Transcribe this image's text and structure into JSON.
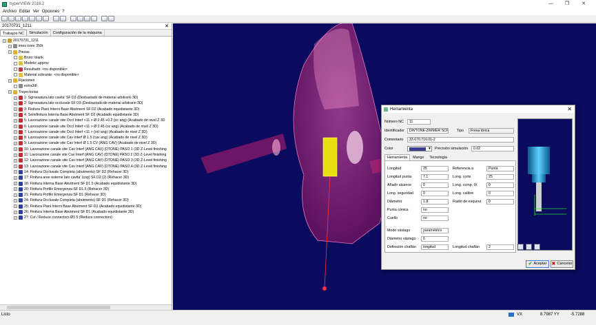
{
  "window": {
    "title": "hyperVIEW 2016.2",
    "controls": [
      "—",
      "❐",
      "✕"
    ]
  },
  "menu": [
    "Archivo",
    "Editar",
    "Ver",
    "Opciones",
    "?"
  ],
  "toolbar": {
    "icons": [
      "new-icon",
      "open-icon",
      "save-icon",
      "print-icon",
      "cut-icon",
      "copy-icon",
      "paste-icon",
      "undo-icon",
      "redo-icon",
      "view-icon",
      "zoom-icon",
      "rotate-icon",
      "fit-icon",
      "measure-icon",
      "line-icon"
    ]
  },
  "left_panel": {
    "header": "20170731_1211",
    "tabs": [
      "Trabajos NC",
      "Simulación",
      "Configuración de la máquina"
    ],
    "tree": [
      {
        "level": 0,
        "text": "20170731_1211",
        "icon": "job-icon",
        "color": "#c8a030"
      },
      {
        "level": 1,
        "text": "imes icore 350i",
        "icon": "machine-icon",
        "color": "#888888"
      },
      {
        "level": 1,
        "text": "Piezas",
        "icon": "folder-icon",
        "color": "#e0b030"
      },
      {
        "level": 2,
        "text": "Bruto: blank",
        "icon": "stock-icon",
        "color": "#e0c040"
      },
      {
        "level": 2,
        "text": "Modelo: approv",
        "icon": "model-icon",
        "color": "#e0c040"
      },
      {
        "level": 2,
        "text": "Resultado: <no disponible>",
        "icon": "result-icon",
        "color": "#c04040"
      },
      {
        "level": 2,
        "text": "Material sobrante: <no disponible>",
        "icon": "rest-icon",
        "color": "#e0c040"
      },
      {
        "level": 1,
        "text": "Fijaciones",
        "icon": "folder-icon",
        "color": "#e0b030"
      },
      {
        "level": 2,
        "text": "extra3df",
        "icon": "fixture-icon",
        "color": "#888888"
      },
      {
        "level": 1,
        "text": "Trayectorias",
        "icon": "folder-icon",
        "color": "#e0b030"
      },
      {
        "level": 2,
        "text": "1: Sgrossatura lato cavita' SF D3 (Desbastado de material arbitrario 3D)",
        "icon": "toolpath-icon",
        "color": "#c03030"
      },
      {
        "level": 2,
        "text": "2: Sgrossatura lato occlusale SF D3 (Desbastado de material arbitrario 3D)",
        "icon": "toolpath-icon",
        "color": "#c03030"
      },
      {
        "level": 2,
        "text": "3: Finitura Piani Interni Base Abutment SF D2 (Acabado equidistante 3D)",
        "icon": "toolpath-icon",
        "color": "#c03030"
      },
      {
        "level": 2,
        "text": "4: Semifinitura Interna Base Abutment SF D2 (Acabado equidistante 3D)",
        "icon": "toolpath-icon",
        "color": "#c03030"
      },
      {
        "level": 2,
        "text": "5: Lavorazione canale vite Occl Interf <11 > Ø 2.45 +0.2 (oc ang) (Acabado de nivel Z 3D",
        "icon": "toolpath-icon",
        "color": "#c03030"
      },
      {
        "level": 2,
        "text": "6: Lavorazione canale vite Occl Interf <11 > Ø 2.45 (oc ang) (Acabado de nivel Z 3D)",
        "icon": "toolpath-icon",
        "color": "#c03030"
      },
      {
        "level": 2,
        "text": "7: Lavorazione canale vite Occl Interf <11 > (ocl ang) (Acabado de nivel Z 3D)",
        "icon": "toolpath-icon",
        "color": "#c03030"
      },
      {
        "level": 2,
        "text": "8: Lavorazione canale vite Cav Interf Ø 1.5 (cav ang) (Acabado de nivel Z 3D)",
        "icon": "toolpath-icon",
        "color": "#c03030"
      },
      {
        "level": 2,
        "text": "9: Lavorazione canale vite Cav Interf Ø 1.5 CV (ANG CAV) (Acabado de nivel Z 3D)",
        "icon": "toolpath-icon",
        "color": "#c03030"
      },
      {
        "level": 2,
        "text": "10: Lavorazione canale vite Cav Interf (ANG CAV) (DTONE) PASO 1 (3D Z-Level finishing",
        "icon": "toolpath-icon",
        "color": "#c03030"
      },
      {
        "level": 2,
        "text": "11: Lavorazione canale vite Cav Interf (ANG CAV) (DTONE) PASO 2 (3D Z-Level finishing",
        "icon": "toolpath-icon",
        "color": "#c03030"
      },
      {
        "level": 2,
        "text": "12: Lavorazione canale vite Cav Interf (ANG CAV) (DTONE) PASO 3 (3D Z-Level finishing",
        "icon": "toolpath-icon",
        "color": "#c03030"
      },
      {
        "level": 2,
        "text": "13: Lavorazione canale vite Cav Interf (ANG CAV) (DTONE) PASO 4 (3D Z-Level finishing",
        "icon": "toolpath-icon",
        "color": "#c03030"
      },
      {
        "level": 2,
        "text": "14: Finitura Occlusale Completa (abutments) SF D2 (Rehacer 3D)",
        "icon": "toolpath-icon",
        "color": "#3040a0"
      },
      {
        "level": 2,
        "text": "17: Finitura aree esterne lato cavita' (cop) SF D2 (2) (Rehacer 3D)",
        "icon": "toolpath-icon",
        "color": "#3040a0"
      },
      {
        "level": 2,
        "text": "18: Finitura Interna Base Abutment SF D1.5 (Acabado equidistante 3D)",
        "icon": "toolpath-icon",
        "color": "#3040a0"
      },
      {
        "level": 2,
        "text": "20: Finitura Profilo Emergenza SF D1.5 (Rehacer 3D)",
        "icon": "toolpath-icon",
        "color": "#3040a0"
      },
      {
        "level": 2,
        "text": "21: Finitura Profilo Emergenza SF D1 (Rehacer 3D)",
        "icon": "toolpath-icon",
        "color": "#3040a0"
      },
      {
        "level": 2,
        "text": "24: Finitura Occlusale Completa (abutments) SF D1 (Rehacer 3D)",
        "icon": "toolpath-icon",
        "color": "#3040a0"
      },
      {
        "level": 2,
        "text": "25: Finitura Piani Interni Base Abutment SF D1 (Acabado equidistante 3D)",
        "icon": "toolpath-icon",
        "color": "#3040a0"
      },
      {
        "level": 2,
        "text": "26: Finitura Interna Base Abutment SF D1 (Acabado equidistante 3D)",
        "icon": "toolpath-icon",
        "color": "#3040a0"
      },
      {
        "level": 2,
        "text": "27: Cut / Reduce connectors Ø1.5 (Reduce connectors)",
        "icon": "toolpath-icon",
        "color": "#3040a0"
      }
    ]
  },
  "status": {
    "left": "Listo",
    "vx_label": "VX",
    "vy_value": "8.7987 YY",
    "value": "-5.7288"
  },
  "dialog": {
    "title": "Herramienta",
    "numero_nc_label": "Número NC",
    "numero_nc": "11",
    "identificador_label": "Identificador",
    "identificador": "DWTONE-ZIMMER SCREW-V",
    "tipo_label": "Tipo",
    "tipo": "Fresa tórica",
    "comentario_label": "Comentario",
    "comentario": "33.670.716.01-2",
    "color_label": "Color",
    "precision_label": "Precisión simulación",
    "precision": "0.02",
    "tabs": [
      "Herramienta",
      "Mango",
      "Tecnología"
    ],
    "fields_left": [
      {
        "label": "Longitud",
        "value": "25"
      },
      {
        "label": "Longitud punta",
        "value": "7.1"
      },
      {
        "label": "Añadir alcance",
        "value": "0"
      },
      {
        "label": "Long. seguridad",
        "value": "0"
      },
      {
        "label": "Diámetro",
        "value": "1.8"
      },
      {
        "label": "Punta cónica",
        "value": "no"
      },
      {
        "label": "Cuello",
        "value": "no"
      }
    ],
    "fields_right": [
      {
        "label": "Referencia a",
        "value": "Punta"
      },
      {
        "label": "Long. corte",
        "value": "25"
      },
      {
        "label": "Long. comp. IX",
        "value": "0"
      },
      {
        "label": "Long. calibre",
        "value": "0"
      },
      {
        "label": "Radio de esquina",
        "value": "0"
      }
    ],
    "modo_label": "Modo vástago",
    "modo": "paramétrico",
    "diam_vastago_label": "Diámetro vástago",
    "diam_vastago": "6",
    "chaflan_label": "Definición chaflán",
    "chaflan": "longitud",
    "long_chaflan_label": "Longitud chaflán",
    "long_chaflan": "2",
    "accept": "Aceptar",
    "cancel": "Cancelar"
  },
  "colors": {
    "viewport_bg": "#0a0a5e",
    "part": "#d0307a",
    "tool": "#e8e010"
  }
}
